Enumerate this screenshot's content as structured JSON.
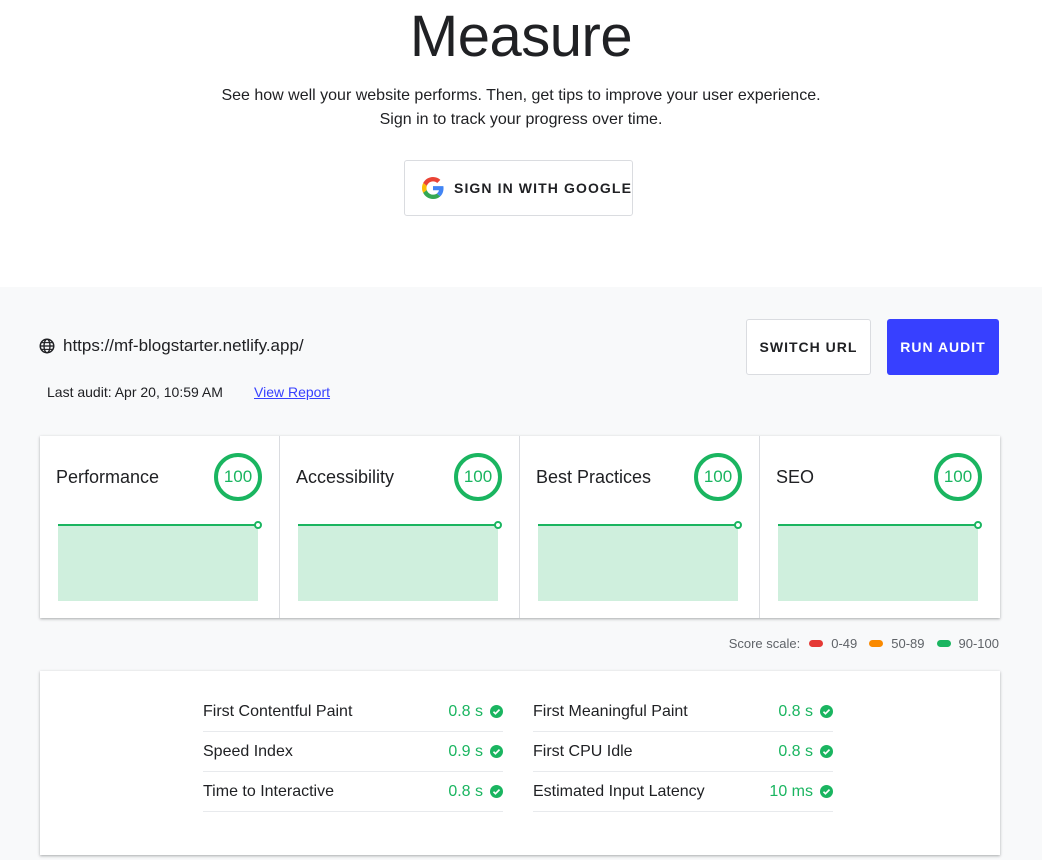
{
  "hero": {
    "title": "Measure",
    "subtitle_line1": "See how well your website performs. Then, get tips to improve your user experience.",
    "subtitle_line2": "Sign in to track your progress over time.",
    "sign_in_label": "SIGN IN WITH GOOGLE",
    "sign_in_icon": "google-g-icon"
  },
  "audit": {
    "url_icon": "globe-icon",
    "url": "https://mf-blogstarter.netlify.app/",
    "last_audit": "Last audit: Apr 20, 10:59 AM",
    "view_report_label": "View Report",
    "switch_url_label": "SWITCH URL",
    "run_audit_label": "RUN AUDIT"
  },
  "colors": {
    "accent": "#3740ff",
    "pass": "#1ab560",
    "pass_fill": "#cfefdd",
    "average": "#fa8a00",
    "fail": "#e53935",
    "band_bg": "#f8f9fa"
  },
  "scores": [
    {
      "label": "Performance",
      "score": "100",
      "history": [
        100,
        100
      ]
    },
    {
      "label": "Accessibility",
      "score": "100",
      "history": [
        100,
        100
      ]
    },
    {
      "label": "Best Practices",
      "score": "100",
      "history": [
        100,
        100
      ]
    },
    {
      "label": "SEO",
      "score": "100",
      "history": [
        100,
        100
      ]
    }
  ],
  "score_scale": {
    "label": "Score scale:",
    "ranges": [
      {
        "label": "0-49",
        "color": "#e53935"
      },
      {
        "label": "50-89",
        "color": "#fa8a00"
      },
      {
        "label": "90-100",
        "color": "#1ab560"
      }
    ]
  },
  "metrics": {
    "left": [
      {
        "name": "First Contentful Paint",
        "value": "0.8 s",
        "status": "pass"
      },
      {
        "name": "Speed Index",
        "value": "0.9 s",
        "status": "pass"
      },
      {
        "name": "Time to Interactive",
        "value": "0.8 s",
        "status": "pass"
      }
    ],
    "right": [
      {
        "name": "First Meaningful Paint",
        "value": "0.8 s",
        "status": "pass"
      },
      {
        "name": "First CPU Idle",
        "value": "0.8 s",
        "status": "pass"
      },
      {
        "name": "Estimated Input Latency",
        "value": "10 ms",
        "status": "pass"
      }
    ]
  }
}
